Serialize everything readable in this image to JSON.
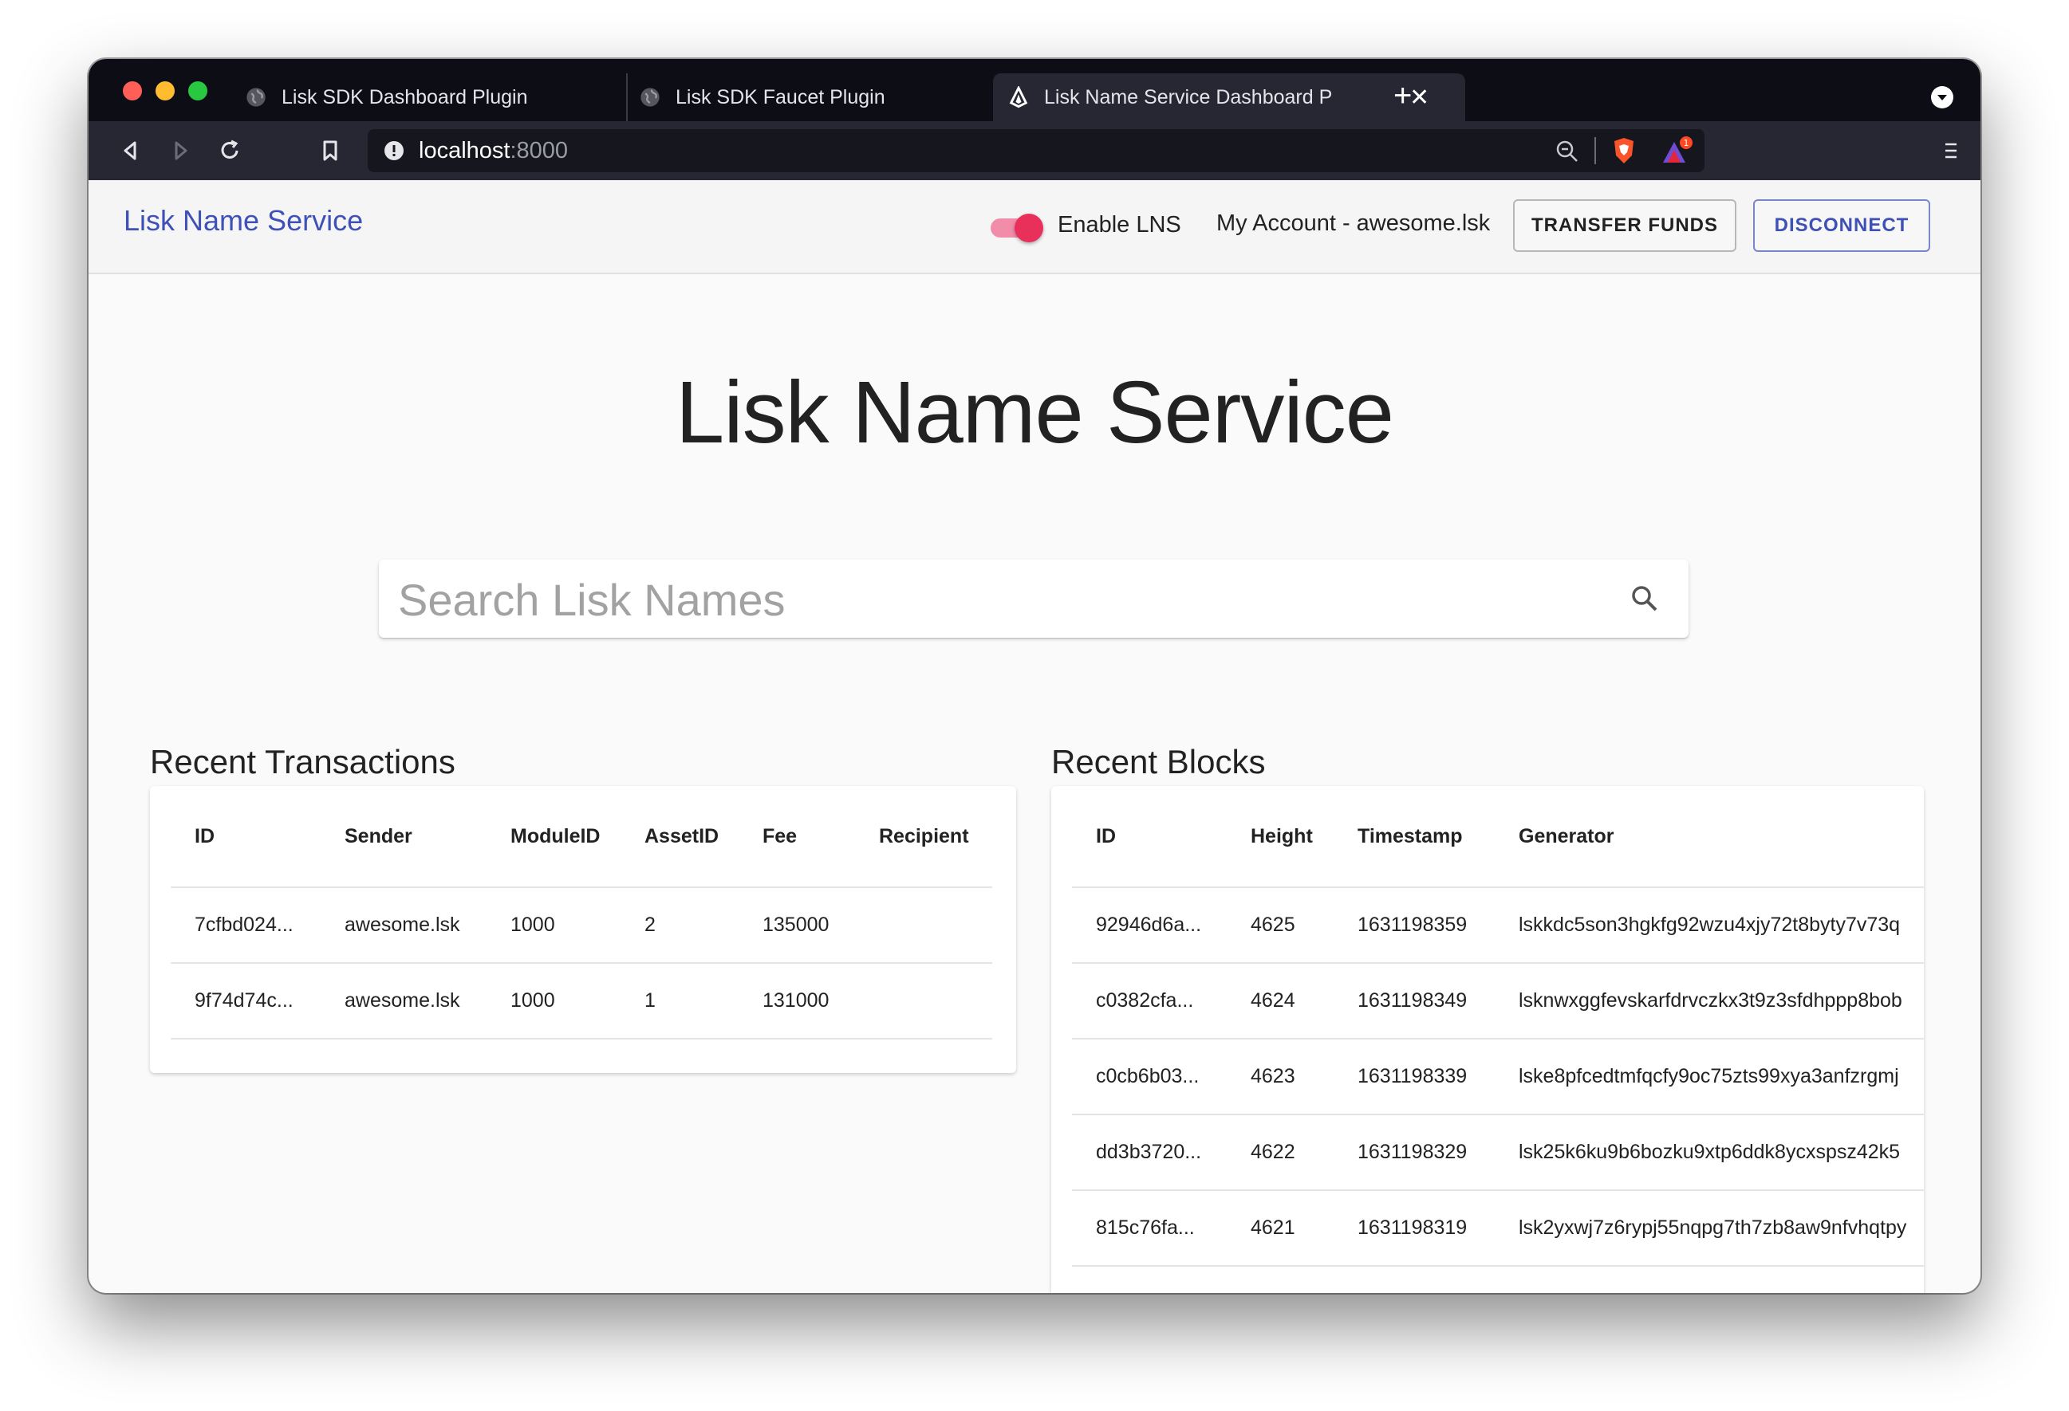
{
  "browser": {
    "tabs": [
      {
        "label": "Lisk SDK Dashboard Plugin",
        "icon": "globe-icon"
      },
      {
        "label": "Lisk SDK Faucet Plugin",
        "icon": "globe-icon"
      },
      {
        "label": "Lisk Name Service Dashboard P",
        "icon": "lisk-logo-icon",
        "active": true
      }
    ],
    "new_tab": "+",
    "close_tab": "✕",
    "url_host": "localhost",
    "url_port": ":8000",
    "extension_badge": "1"
  },
  "appbar": {
    "brand": "Lisk Name Service",
    "toggle_label": "Enable LNS",
    "toggle_on": true,
    "account": "My Account - awesome.lsk",
    "transfer_button": "TRANSFER FUNDS",
    "disconnect_button": "DISCONNECT"
  },
  "hero_title": "Lisk Name Service",
  "search": {
    "placeholder": "Search Lisk Names"
  },
  "transactions": {
    "title": "Recent Transactions",
    "columns": [
      "ID",
      "Sender",
      "ModuleID",
      "AssetID",
      "Fee",
      "Recipient"
    ],
    "rows": [
      [
        "7cfbd024...",
        "awesome.lsk",
        "1000",
        "2",
        "135000",
        ""
      ],
      [
        "9f74d74c...",
        "awesome.lsk",
        "1000",
        "1",
        "131000",
        ""
      ]
    ]
  },
  "blocks": {
    "title": "Recent Blocks",
    "columns": [
      "ID",
      "Height",
      "Timestamp",
      "Generator"
    ],
    "rows": [
      [
        "92946d6a...",
        "4625",
        "1631198359",
        "lskkdc5son3hgkfg92wzu4xjy72t8byty7v73q"
      ],
      [
        "c0382cfa...",
        "4624",
        "1631198349",
        "lsknwxggfevskarfdrvczkx3t9z3sfdhppp8bob"
      ],
      [
        "c0cb6b03...",
        "4623",
        "1631198339",
        "lske8pfcedtmfqcfy9oc75zts99xya3anfzrgmj"
      ],
      [
        "dd3b3720...",
        "4622",
        "1631198329",
        "lsk25k6ku9b6bozku9xtp6ddk8ycxspsz42k5"
      ],
      [
        "815c76fa...",
        "4621",
        "1631198319",
        "lsk2yxwj7z6rypj55nqpg7th7zb8aw9nfvhqtpy"
      ]
    ]
  },
  "colors": {
    "brand": "#3f51b5",
    "toggle": "#e8305b",
    "tabbar": "#0d0e15",
    "toolbar": "#262733"
  }
}
